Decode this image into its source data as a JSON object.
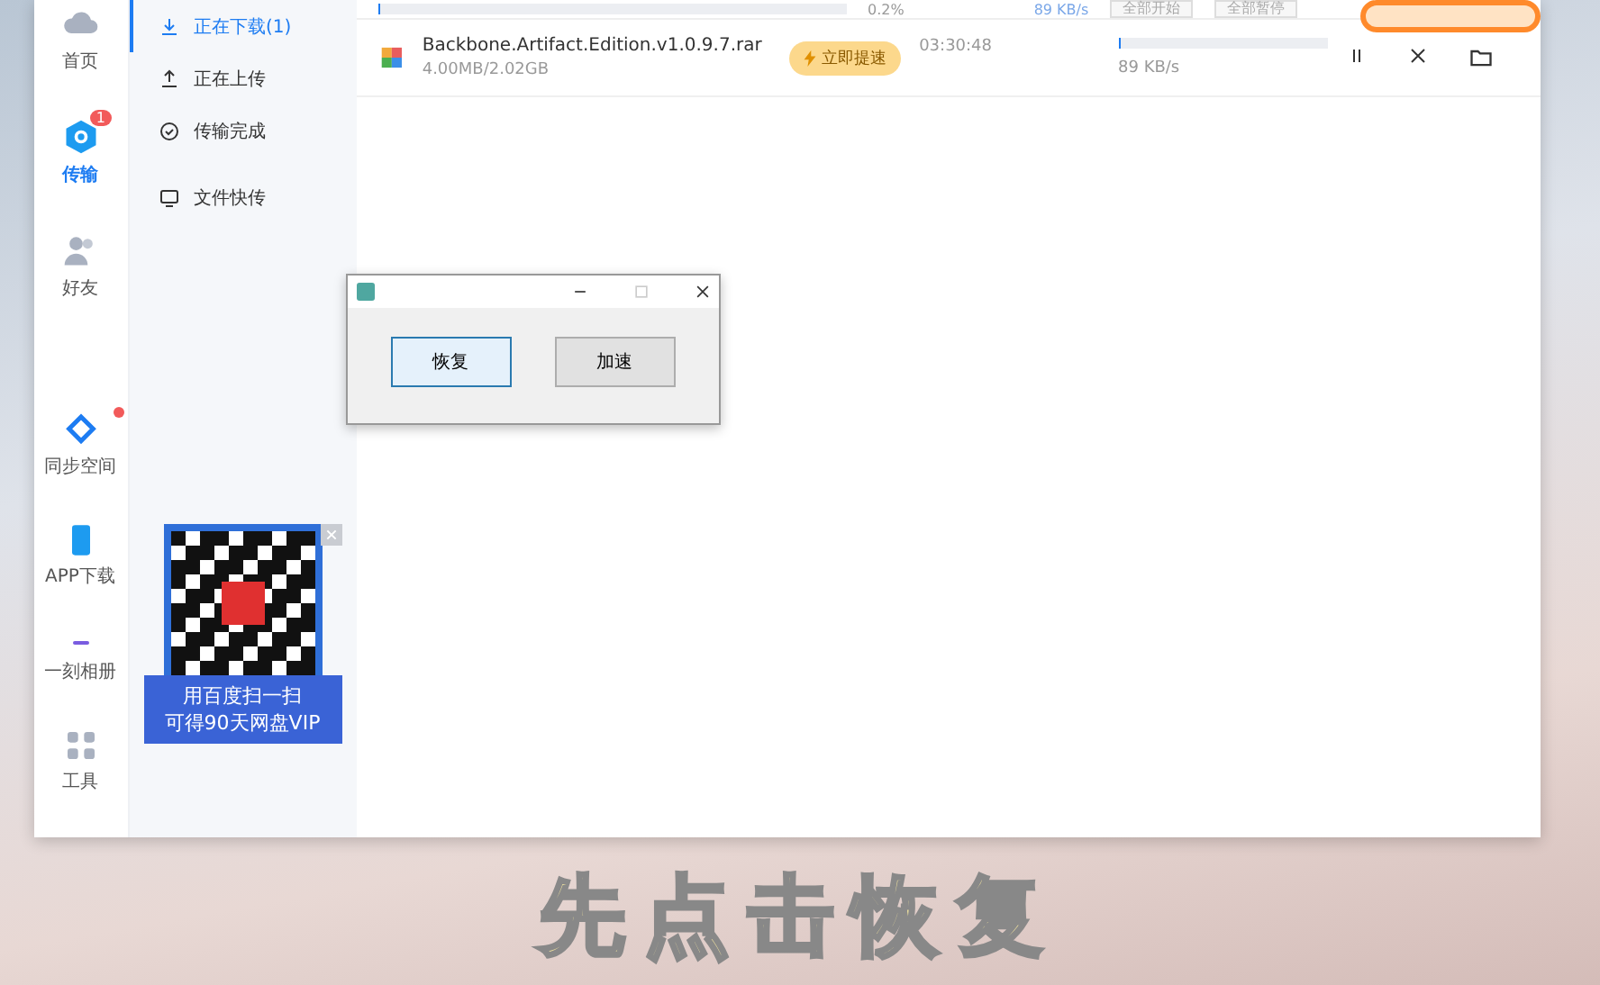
{
  "rail": {
    "items": [
      {
        "kind": "cloud",
        "label": "首页",
        "selected": false
      },
      {
        "kind": "transfer",
        "label": "传输",
        "selected": true,
        "badge": "1"
      },
      {
        "kind": "friends",
        "label": "好友",
        "selected": false
      }
    ],
    "bottom_items": [
      {
        "kind": "sync",
        "label": "同步空间",
        "dot": true
      },
      {
        "kind": "phone",
        "label": "APP下载",
        "dot": false
      },
      {
        "kind": "album",
        "label": "一刻相册",
        "dot": false
      },
      {
        "kind": "tools",
        "label": "工具",
        "dot": false
      }
    ]
  },
  "sidebar": {
    "items": [
      {
        "kind": "download",
        "label": "正在下载(1)",
        "selected": true
      },
      {
        "kind": "upload",
        "label": "正在上传",
        "selected": false
      },
      {
        "kind": "done",
        "label": "传输完成",
        "selected": false
      },
      {
        "kind": "quick",
        "label": "文件快传",
        "selected": false
      }
    ]
  },
  "promo": {
    "lines": [
      "用百度扫一扫",
      "可得90天网盘VIP"
    ]
  },
  "toolbar": {
    "progress_text": "0.2%",
    "progress": {
      "level": 0.002
    },
    "speed": "89 KB/s",
    "buttons": [
      "全部开始",
      "全部暂停"
    ]
  },
  "downloads": [
    {
      "name": "Backbone.Artifact.Edition.v1.0.9.7.rar",
      "size": "4.00MB/2.02GB",
      "boost": "立即提速",
      "time": "03:30:48",
      "level": 0.002,
      "speed": "89 KB/s"
    }
  ],
  "dialog": {
    "buttons": [
      {
        "label": "恢复",
        "selected": true
      },
      {
        "label": "加速",
        "selected": false
      }
    ]
  },
  "caption": "先点击恢复"
}
